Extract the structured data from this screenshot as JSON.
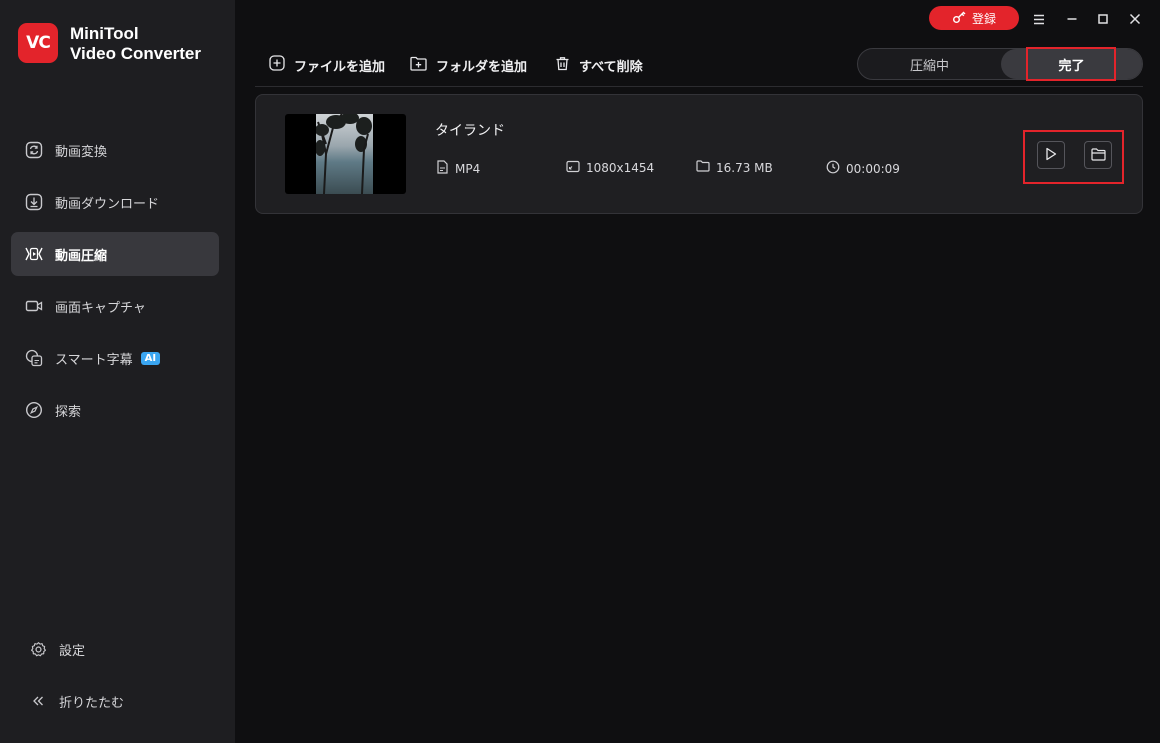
{
  "app": {
    "logo_mark": "VC",
    "name_line1": "MiniTool",
    "name_line2": "Video Converter"
  },
  "colors": {
    "accent": "#e3242b",
    "ai_badge": "#3aa6f2",
    "sidebar_bg": "#1e1e21",
    "main_bg": "#0f0f11"
  },
  "sidebar": {
    "items": [
      {
        "label": "動画変換",
        "icon": "convert-icon"
      },
      {
        "label": "動画ダウンロード",
        "icon": "download-icon"
      },
      {
        "label": "動画圧縮",
        "icon": "compress-icon",
        "active": true
      },
      {
        "label": "画面キャプチャ",
        "icon": "camera-icon"
      },
      {
        "label": "スマート字幕",
        "icon": "subtitle-icon",
        "badge": "AI"
      },
      {
        "label": "探索",
        "icon": "compass-icon"
      }
    ],
    "settings_label": "設定",
    "collapse_label": "折りたたむ"
  },
  "titlebar": {
    "register_label": "登録"
  },
  "toolbar": {
    "add_file": "ファイルを追加",
    "add_folder": "フォルダを追加",
    "delete_all": "すべて削除"
  },
  "tabs": {
    "compressing": "圧縮中",
    "done": "完了"
  },
  "file": {
    "name": "タイランド",
    "format": "MP4",
    "resolution": "1080x1454",
    "size": "16.73 MB",
    "duration": "00:00:09"
  }
}
